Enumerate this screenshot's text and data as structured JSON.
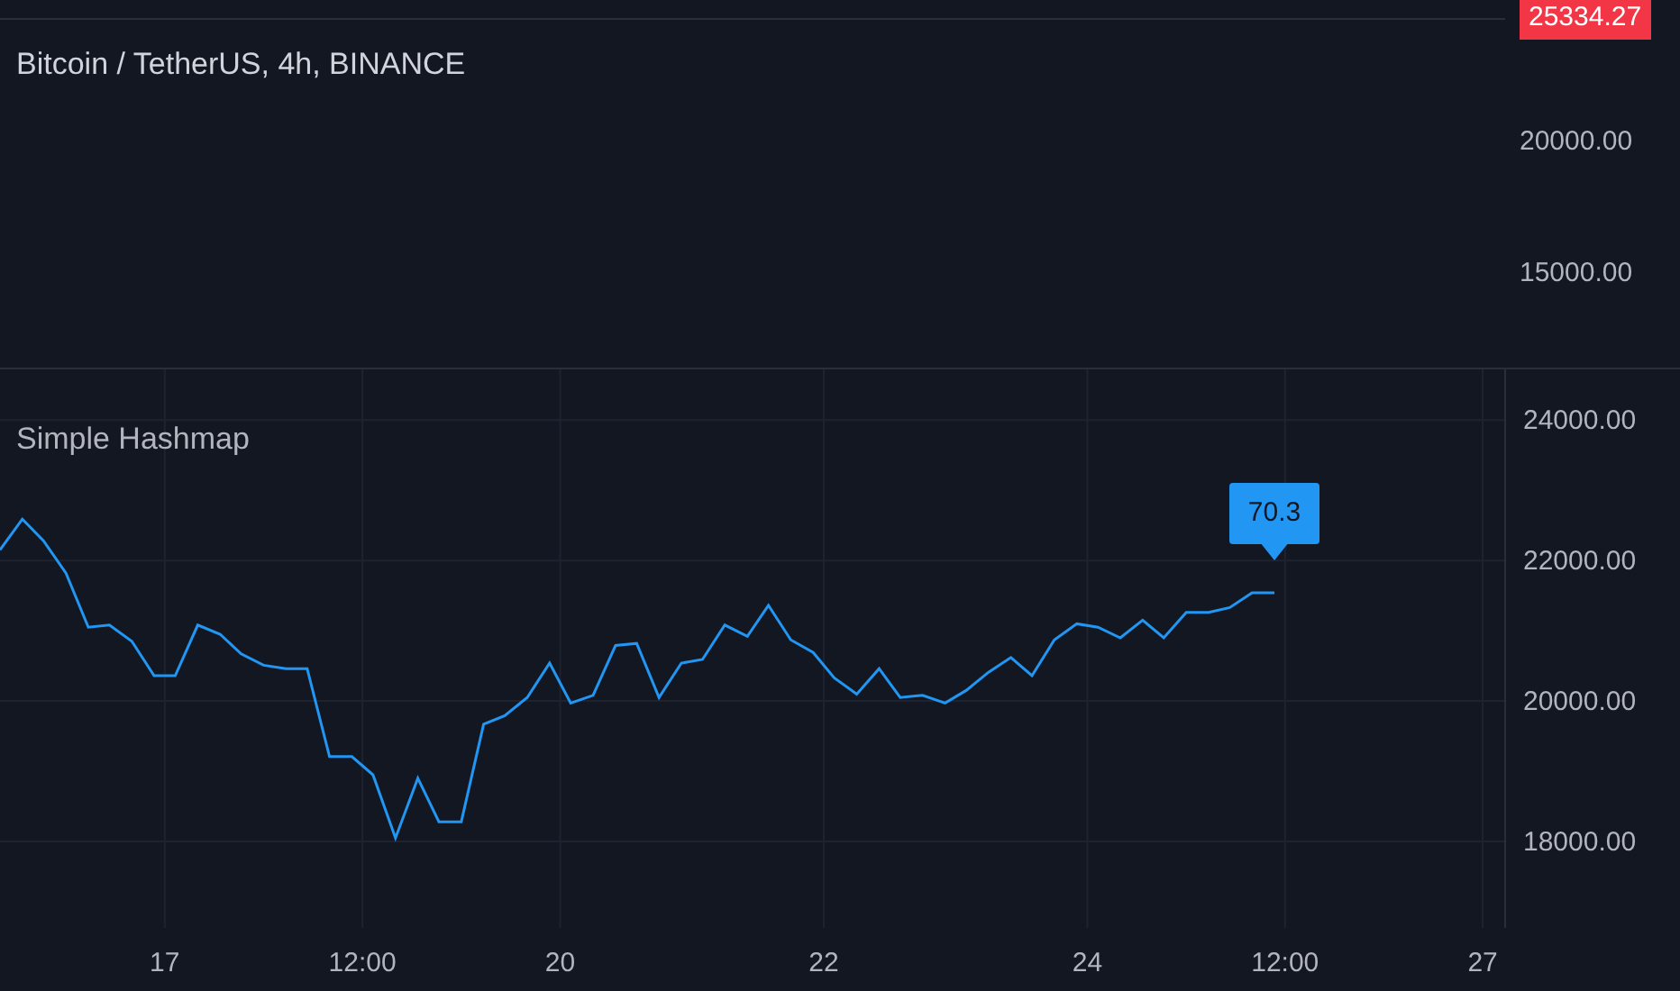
{
  "main_pane": {
    "title": "Bitcoin / TetherUS, 4h, BINANCE",
    "price_label": "25334.27",
    "axis_labels": [
      "20000.00",
      "15000.00"
    ]
  },
  "indicator_pane": {
    "title": "Simple Hashmap",
    "value_label": "70.3",
    "chart_data": {
      "type": "line",
      "x": [
        15.75,
        15.92,
        16.08,
        16.25,
        16.42,
        16.58,
        16.75,
        16.92,
        17.08,
        17.25,
        17.42,
        17.58,
        17.75,
        17.92,
        18.08,
        18.25,
        18.42,
        18.58,
        18.75,
        18.92,
        19.08,
        19.25,
        19.42,
        19.58,
        19.75,
        19.92,
        20.08,
        20.25,
        20.42,
        20.58,
        20.75,
        20.92,
        21.08,
        21.25,
        21.42,
        21.58,
        21.75,
        21.92,
        22.08,
        22.25,
        22.42,
        22.58,
        22.75,
        22.92,
        23.08,
        23.25,
        23.42,
        23.58,
        23.75,
        23.92,
        24.08,
        24.25,
        24.42,
        24.58,
        24.75,
        24.92,
        25.08,
        25.25,
        25.42
      ],
      "series": [
        {
          "color": "#2196f3",
          "values": [
            22150,
            22590,
            22280,
            21820,
            21050,
            21080,
            20850,
            20360,
            20360,
            21080,
            20950,
            20670,
            20510,
            20460,
            20460,
            19210,
            19210,
            18950,
            18050,
            18900,
            18280,
            18280,
            19670,
            19790,
            20050,
            20540,
            19970,
            20080,
            20790,
            20820,
            20050,
            20540,
            20590,
            21080,
            20920,
            21360,
            20870,
            20690,
            20330,
            20100,
            20460,
            20050,
            20080,
            19970,
            20150,
            20410,
            20620,
            20360,
            20870,
            21100,
            21050,
            20900,
            21150,
            20900,
            21260,
            21260,
            21330,
            21540,
            21540
          ]
        }
      ],
      "xlim": [
        15.75,
        27.17
      ],
      "grid": true,
      "ylim": [
        16770,
        24720
      ],
      "yticks": [
        {
          "value": 24000,
          "label": "24000.00"
        },
        {
          "value": 22000,
          "label": "22000.00"
        },
        {
          "value": 20000,
          "label": "20000.00"
        },
        {
          "value": 18000,
          "label": "18000.00"
        }
      ],
      "xticks": [
        17,
        20,
        22,
        24,
        27
      ]
    },
    "midday_ticks": [
      "12:00",
      "12:00"
    ]
  }
}
